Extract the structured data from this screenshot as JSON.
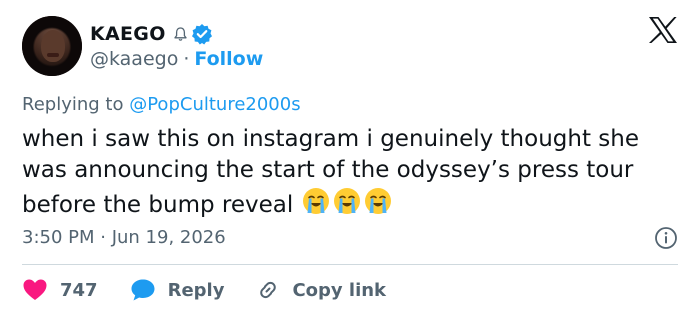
{
  "author": {
    "display_name": "KAEGO",
    "handle": "@kaaego",
    "follow_label": "Follow",
    "separator": "·"
  },
  "reply": {
    "prefix": "Replying to",
    "mention": "@PopCulture2000s"
  },
  "tweet": {
    "text": "when i saw this on instagram i genuinely thought she was announcing the start of the odyssey’s press tour before the bump reveal",
    "emojis": [
      "loudly-crying-face",
      "loudly-crying-face",
      "loudly-crying-face"
    ]
  },
  "timestamp": "3:50 PM · Jun 19, 2026",
  "actions": {
    "likes": "747",
    "reply_label": "Reply",
    "copy_label": "Copy link"
  },
  "icons": {
    "brand": "x-logo",
    "verified": "verified-badge-icon",
    "notification": "bell-icon",
    "info": "info-icon",
    "like": "heart-icon",
    "reply": "speech-bubble-icon",
    "copy": "link-icon"
  },
  "colors": {
    "accent": "#1d9bf0",
    "like": "#f91880",
    "muted": "#536471",
    "text": "#0f1419",
    "divider": "#cfd9de"
  }
}
